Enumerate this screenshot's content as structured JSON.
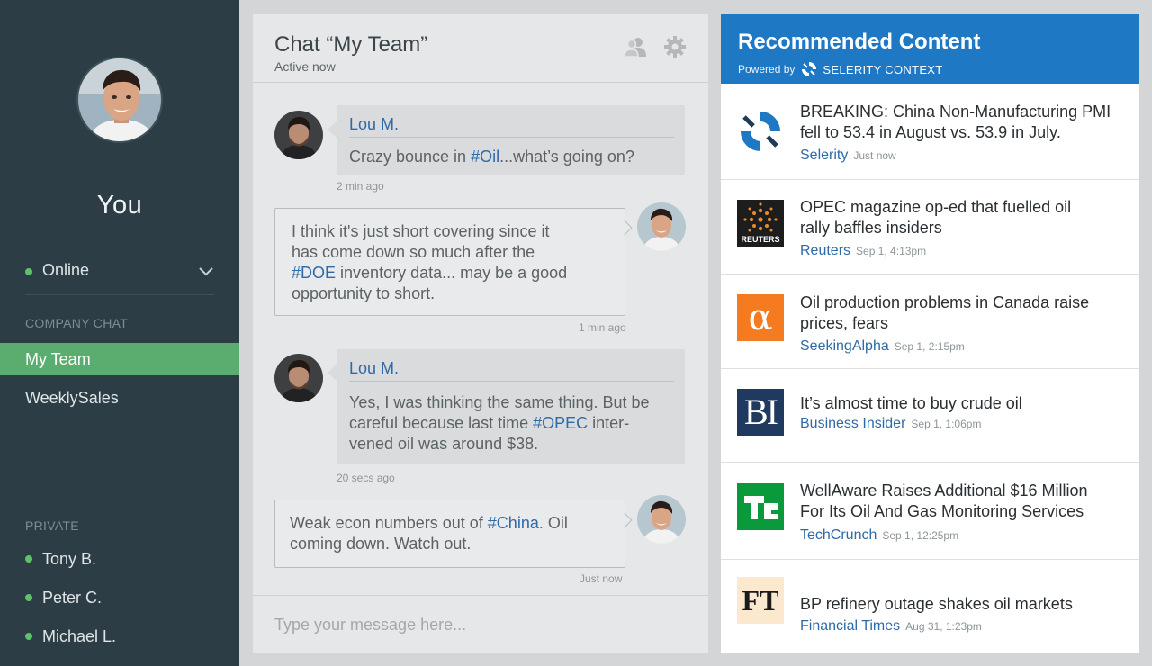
{
  "sidebar": {
    "user_name": "You",
    "status": "Online",
    "company_heading": "COMPANY CHAT",
    "company_items": [
      "My Team",
      "WeeklySales"
    ],
    "private_heading": "PRIVATE",
    "private_items": [
      "Tony B.",
      "Peter C.",
      "Michael L."
    ]
  },
  "chat": {
    "title": "Chat “My Team”",
    "subtitle": "Active now",
    "messages": [
      {
        "sender": "Lou M.",
        "text_before": "Crazy bounce in ",
        "tag": "#Oil",
        "text_after": "...what’s going on?",
        "time": "2 min ago"
      },
      {
        "line1": "I think it's just short covering since it",
        "line2": "has come down so much after the",
        "tag": "#DOE",
        "line3_after": " inventory data... may be a good",
        "line4": "opportunity to short.",
        "time": "1 min ago"
      },
      {
        "sender": "Lou M.",
        "line1": "Yes, I was thinking the same thing. But be",
        "line2_before": "careful because last time ",
        "tag": "#OPEC",
        "line2_after": " inter-",
        "line3": "vened oil was around $38.",
        "time": "20 secs ago"
      },
      {
        "line1_before": "Weak econ numbers out of ",
        "tag": "#China",
        "line1_after": ". Oil",
        "line2": "coming down. Watch out.",
        "time": "Just now"
      }
    ],
    "composer_placeholder": "Type your message here..."
  },
  "recommended": {
    "title": "Recommended Content",
    "powered_by": "Powered by",
    "brand": "SELERITY CONTEXT",
    "items": [
      {
        "line1": "BREAKING: China Non-Manufacturing PMI",
        "line2": "fell to 53.4 in August vs. 53.9 in July.",
        "source": "Selerity",
        "time": "Just now"
      },
      {
        "line1": "OPEC magazine op-ed that fuelled oil",
        "line2": "rally baffles insiders",
        "source": "Reuters",
        "time": "Sep 1, 4:13pm",
        "logo_text": "REUTERS"
      },
      {
        "line1": "Oil production problems in Canada raise",
        "line2": "prices, fears",
        "source": "SeekingAlpha",
        "time": "Sep 1, 2:15pm",
        "logo_text": "α"
      },
      {
        "line1": "It’s almost time to buy crude oil",
        "source": "Business Insider",
        "time": "Sep 1, 1:06pm",
        "logo_text": "BI"
      },
      {
        "line1": "WellAware Raises Additional $16 Million",
        "line2": "For Its Oil And Gas Monitoring Services",
        "source": "TechCrunch",
        "time": "Sep 1, 12:25pm",
        "logo_text": "TC"
      },
      {
        "line1": "BP refinery outage shakes oil markets",
        "source": "Financial Times",
        "time": "Aug 31, 1:23pm",
        "logo_text": "FT"
      }
    ]
  },
  "colors": {
    "sidebar_bg": "#2d3d45",
    "accent_green": "#5aad6e",
    "online_dot": "#5fc26b",
    "link_blue": "#2f6aa8",
    "rec_header_blue": "#1f78c4"
  }
}
